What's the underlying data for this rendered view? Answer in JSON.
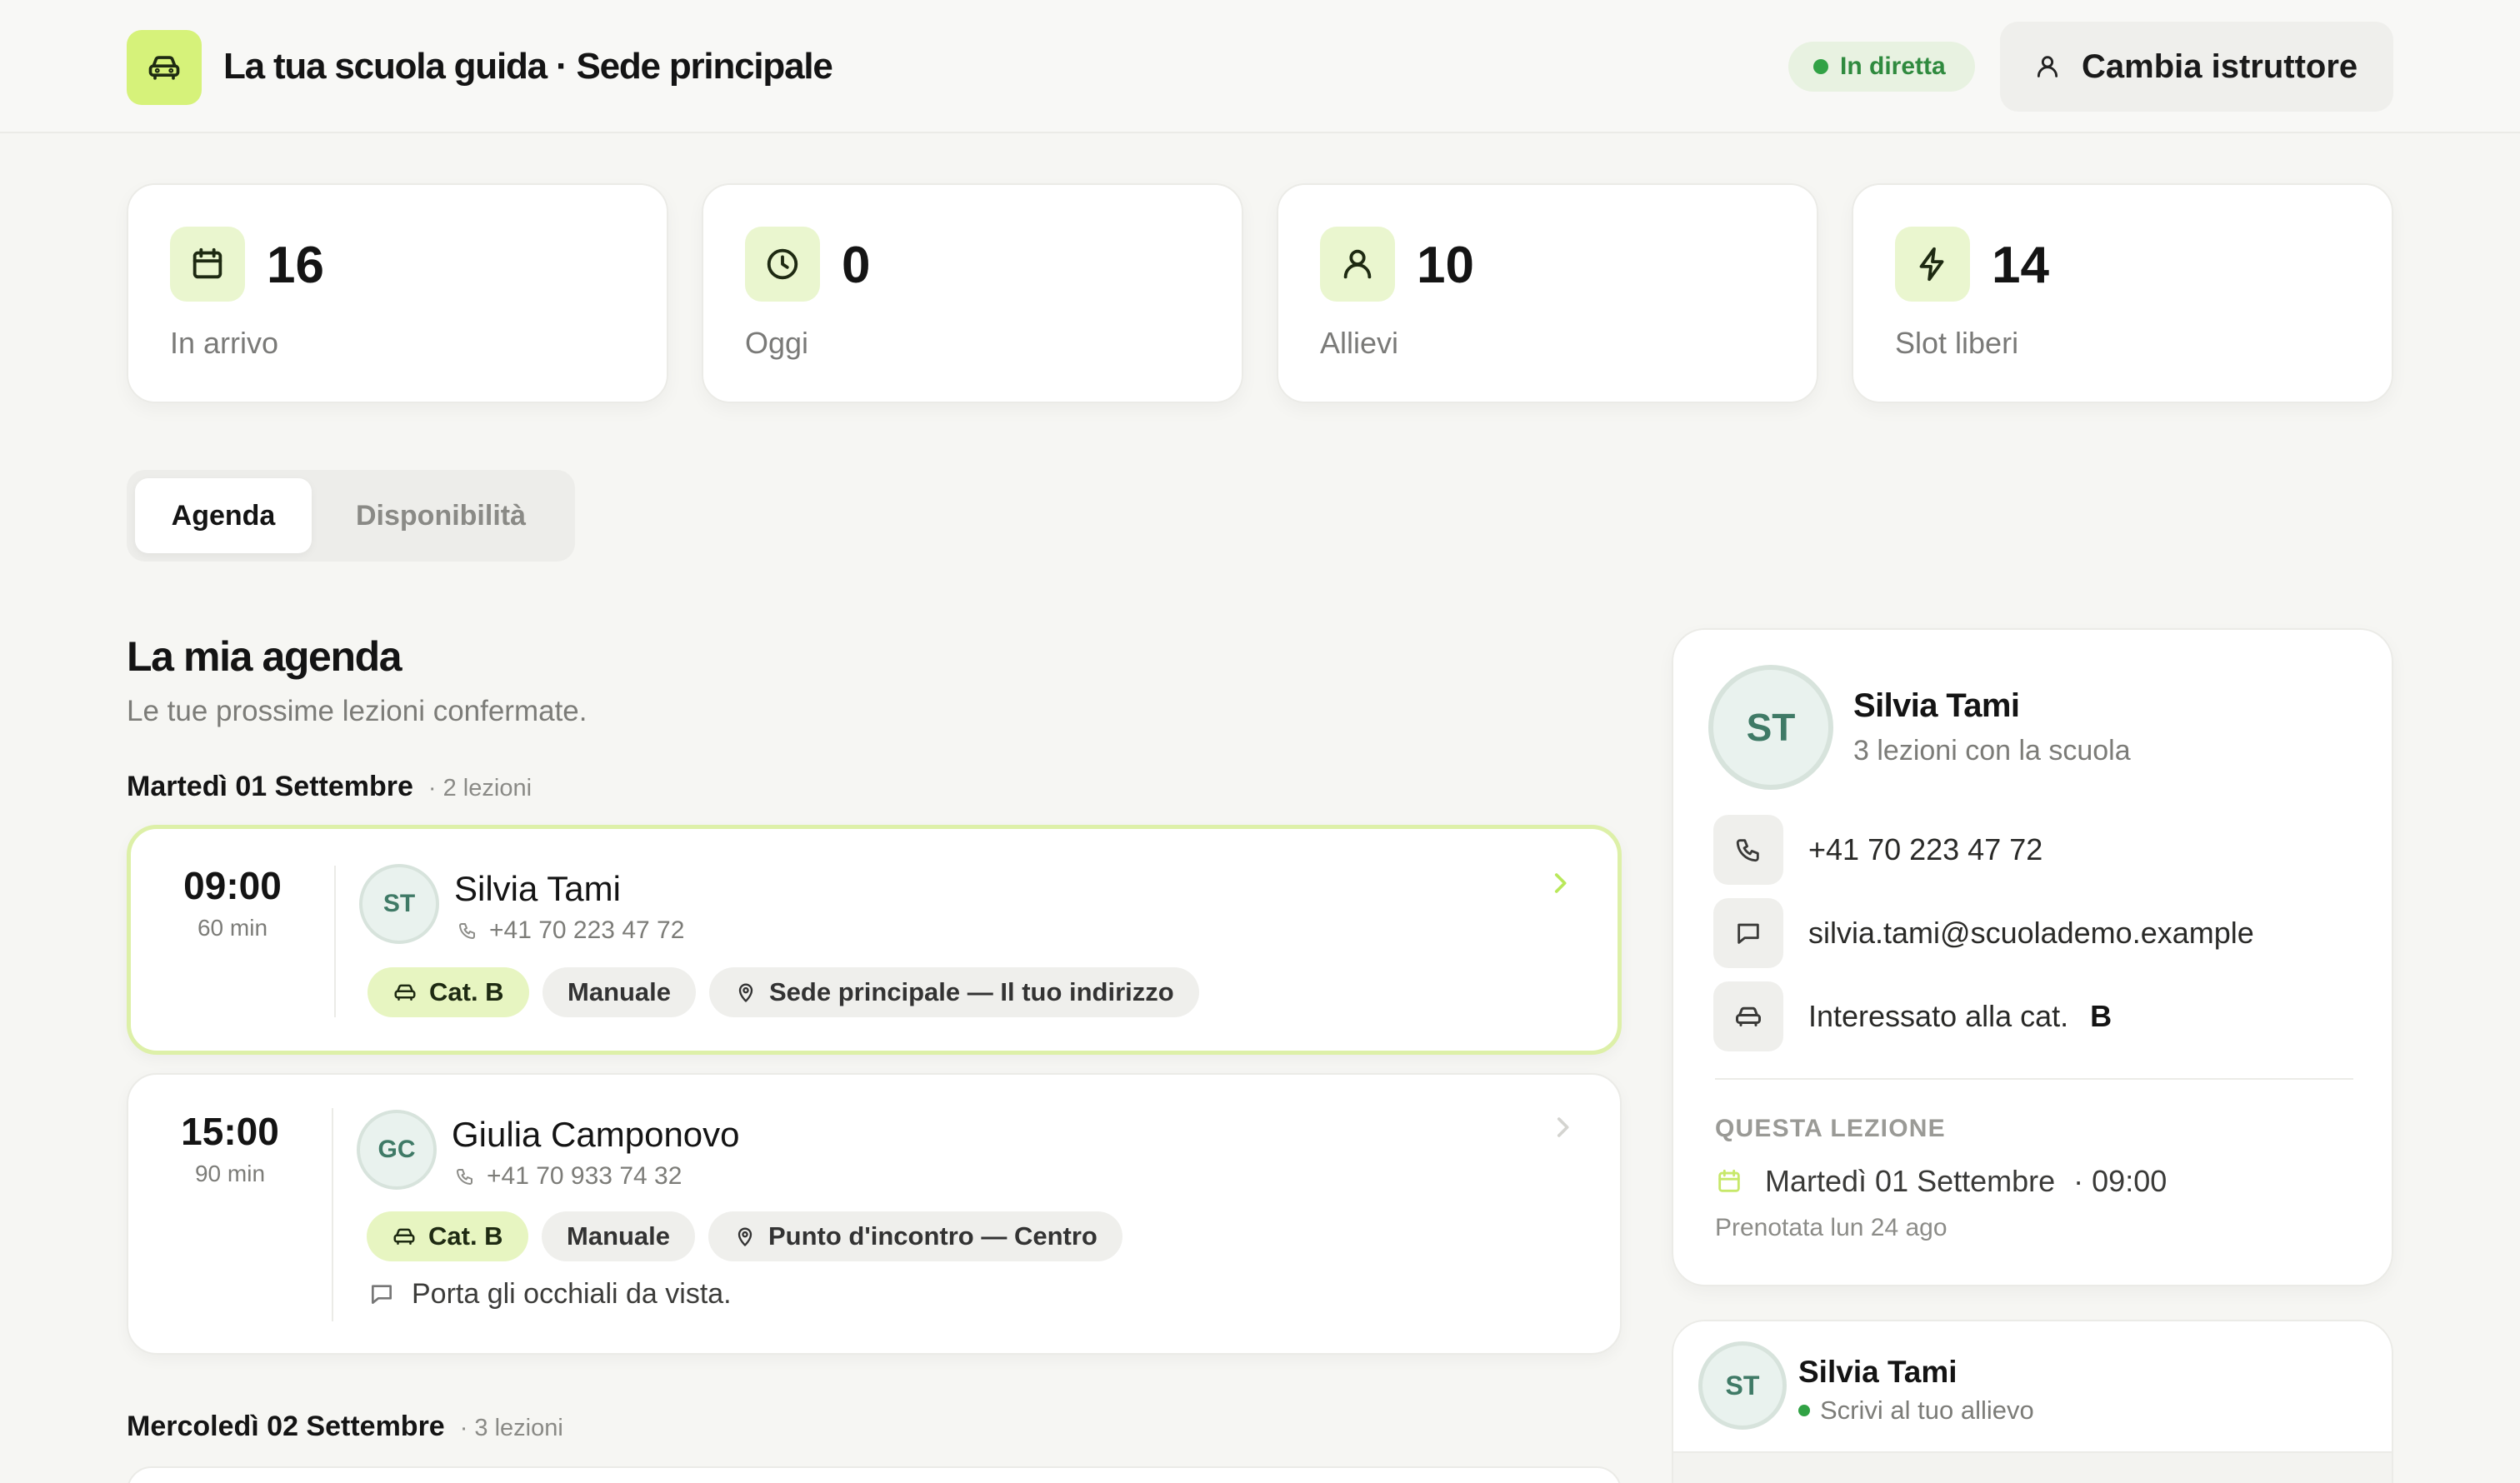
{
  "header": {
    "brand": "La tua scuola guida · Sede principale",
    "logo_icon": "car-icon",
    "live_label": "In diretta",
    "switch_label": "Cambia istruttore",
    "switch_icon": "user-icon"
  },
  "stats": [
    {
      "value": "16",
      "label": "In arrivo",
      "icon": "calendar-icon"
    },
    {
      "value": "0",
      "label": "Oggi",
      "icon": "clock-icon"
    },
    {
      "value": "10",
      "label": "Allievi",
      "icon": "user-icon"
    },
    {
      "value": "14",
      "label": "Slot liberi",
      "icon": "lightning-icon"
    }
  ],
  "tabs": [
    {
      "label": "Agenda",
      "active": true
    },
    {
      "label": "Disponibilità",
      "active": false
    }
  ],
  "agenda": {
    "title": "La mia agenda",
    "subtitle": "Le tue prossime lezioni confermate.",
    "days": [
      {
        "heading": "Martedì 01 Settembre",
        "count": "· 2 lezioni",
        "lessons": [
          {
            "time": "09:00",
            "duration": "60 min",
            "initials": "ST",
            "name": "Silvia Tami",
            "phone": "+41 70 223 47 72",
            "category": "Cat. B",
            "gearbox": "Manuale",
            "location": "Sede principale — Il tuo indirizzo",
            "note": ""
          },
          {
            "time": "15:00",
            "duration": "90 min",
            "initials": "GC",
            "name": "Giulia Camponovo",
            "phone": "+41 70 933 74 32",
            "category": "Cat. B",
            "gearbox": "Manuale",
            "location": "Punto d'incontro — Centro",
            "note": "Porta gli occhiali da vista."
          }
        ]
      },
      {
        "heading": "Mercoledì 02 Settembre",
        "count": "· 3 lezioni",
        "lessons": []
      }
    ]
  },
  "profile": {
    "initials": "ST",
    "name": "Silvia Tami",
    "subtitle": "3 lezioni con la scuola",
    "phone": "+41 70 223 47 72",
    "email": "silvia.tami@scuolademo.example",
    "interest_label": "Interessato alla cat.",
    "interest_value": "B",
    "section_label": "QUESTA LEZIONE",
    "lesson_date": "Martedì 01 Settembre",
    "lesson_time": "· 09:00",
    "booked": "Prenotata lun 24 ago"
  },
  "chat": {
    "initials": "ST",
    "name": "Silvia Tami",
    "status": "Scrivi al tuo allievo"
  },
  "colors": {
    "accent": "#d6f27a",
    "accent_soft": "#eaf6cf",
    "live_green": "#31a245",
    "background": "#f6f6f3"
  }
}
